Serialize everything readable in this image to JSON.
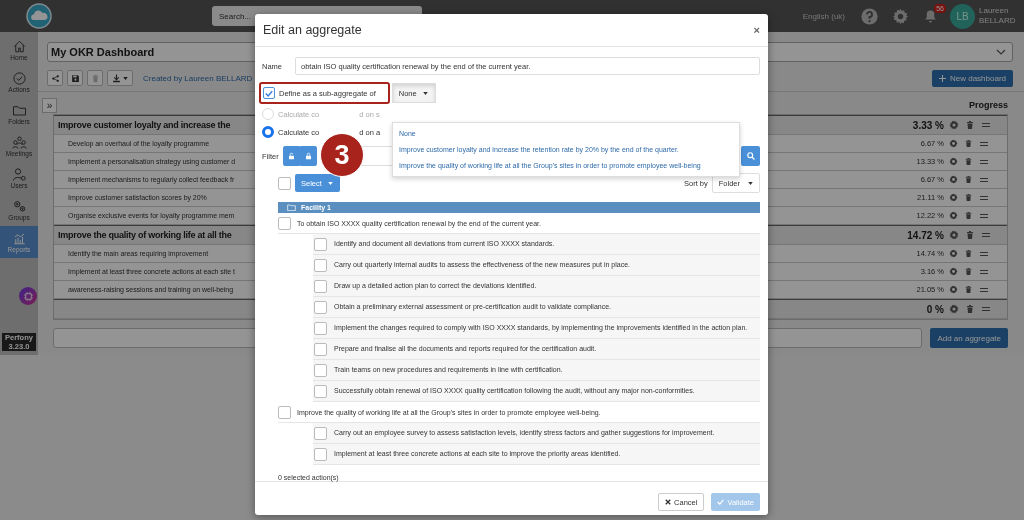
{
  "top_bar": {
    "search": {
      "placeholder": "Search..."
    },
    "language": "English (uk)",
    "notification_count": "56",
    "avatar": "LB",
    "user_name": "Laureen BELLARD"
  },
  "sidebar": {
    "items": [
      {
        "label": "Home",
        "kind": "home",
        "selected": false
      },
      {
        "label": "Actions",
        "kind": "actions",
        "selected": false
      },
      {
        "label": "Folders",
        "kind": "folders",
        "selected": false
      },
      {
        "label": "Meetings",
        "kind": "meetings",
        "selected": false
      },
      {
        "label": "Users",
        "kind": "users",
        "selected": false
      },
      {
        "label": "Groups",
        "kind": "groups",
        "selected": false
      },
      {
        "label": "Reports",
        "kind": "reports",
        "selected": true
      }
    ],
    "app_name": "Perfony",
    "version": "3.23.0"
  },
  "dashboard": {
    "title": "My OKR Dashboard",
    "toolbar": [
      {
        "kind": "share",
        "disabled": false
      },
      {
        "kind": "save",
        "disabled": false
      },
      {
        "kind": "delete",
        "disabled": true
      },
      {
        "kind": "download",
        "disabled": false
      }
    ],
    "created_by": "Created by Laureen BELLARD",
    "new_button": "New dashboard",
    "expand_button": "»",
    "progress_header": "Progress",
    "rows": [
      {
        "kind": "group",
        "name": "Improve customer loyalty and increase the",
        "progress": "3.33 %"
      },
      {
        "kind": "item",
        "name": "Develop an overhaul of the loyalty programme",
        "progress": "6.67 %"
      },
      {
        "kind": "item",
        "name": "Implement a personalisation strategy using customer d",
        "progress": "13.33 %"
      },
      {
        "kind": "item",
        "name": "Implement mechanisms to regularly collect feedback fr",
        "progress": "6.67 %"
      },
      {
        "kind": "item",
        "name": "Improve customer satisfaction scores by 20%",
        "progress": "21.11 %"
      },
      {
        "kind": "item",
        "name": "Organise exclusive events for loyalty programme mem",
        "progress": "12.22 %"
      },
      {
        "kind": "group",
        "name": "Improve the quality of working life at all the",
        "progress": "14.72 %"
      },
      {
        "kind": "item",
        "name": "Identify the main areas requiring improvement",
        "progress": "14.74 %"
      },
      {
        "kind": "item",
        "name": "Implement at least three concrete actions at each site t",
        "progress": "3.16 %"
      },
      {
        "kind": "item",
        "name": "awareness-raising sessions and training on well-being",
        "progress": "21.05 %"
      },
      {
        "kind": "group",
        "progress": "0 %"
      }
    ],
    "add_button": "Add an aggregate"
  },
  "modal": {
    "title": "Edit an aggregate",
    "close": "×",
    "name_label": "Name",
    "name_value": "obtain ISO quality certification renewal by the end of the current year.",
    "sub_aggregate": {
      "label": "Define as a sub-aggregate of",
      "checked": true,
      "value": "None",
      "expanded": true,
      "options": [
        {
          "label": "None"
        },
        {
          "label": "Improve customer loyalty and increase the retention rate by 20% by the end of the quarter."
        },
        {
          "label": "Improve the quality of working life at all the Group's sites in order to promote employee well-being"
        }
      ]
    },
    "step_badge": "3",
    "calc_options": [
      {
        "label_start": "Calculate co",
        "label_end": "d on s",
        "selected": false,
        "disabled": true
      },
      {
        "label_start": "Calculate co",
        "label_end": "d on a",
        "selected": true,
        "disabled": false
      }
    ],
    "filter_label": "Filter",
    "lock_filters": [
      {
        "kind": "unlocked",
        "on": true
      },
      {
        "kind": "locked",
        "on": true
      }
    ],
    "select_all_checked": false,
    "select_button": "Select",
    "sort_label": "Sort by",
    "sort_value": "Folder",
    "folder": "Facility 1",
    "actions": [
      {
        "label": "To obtain ISO XXXX quality certification renewal by the end of the current year.",
        "checked": false,
        "children": [
          {
            "label": "Identify and document all deviations from current ISO XXXX standards.",
            "checked": false
          },
          {
            "label": "Carry out quarterly internal audits to assess the effectiveness of the new measures put in place.",
            "checked": false
          },
          {
            "label": "Draw up a detailed action plan to correct the deviations identified.",
            "checked": false
          },
          {
            "label": "Obtain a preliminary external assessment or pre-certification audit to validate compliance.",
            "checked": false
          },
          {
            "label": "Implement the changes required to comply with ISO XXXX standards, by implementing the improvements identified in the action plan.",
            "checked": false
          },
          {
            "label": "Prepare and finalise all the documents and reports required for the certification audit.",
            "checked": false
          },
          {
            "label": "Train teams on new procedures and requirements in line with certification.",
            "checked": false
          },
          {
            "label": "Successfully obtain renewal of ISO XXXX quality certification following the audit, without any major non-conformities.",
            "checked": false
          }
        ]
      },
      {
        "label": "Improve the quality of working life at all the Group's sites in order to promote employee well-being.",
        "checked": false,
        "children": [
          {
            "label": "Carry out an employee survey to assess satisfaction levels, identify stress factors and gather suggestions for improvement.",
            "checked": false
          },
          {
            "label": "Implement at least three concrete actions at each site to improve the priority areas identified.",
            "checked": false
          }
        ]
      }
    ],
    "selected_count": "0 selected action(s)",
    "buttons": [
      {
        "kind": "cancel",
        "label": "Cancel",
        "disabled": false
      },
      {
        "kind": "validate",
        "label": "Validate",
        "disabled": true
      }
    ]
  }
}
